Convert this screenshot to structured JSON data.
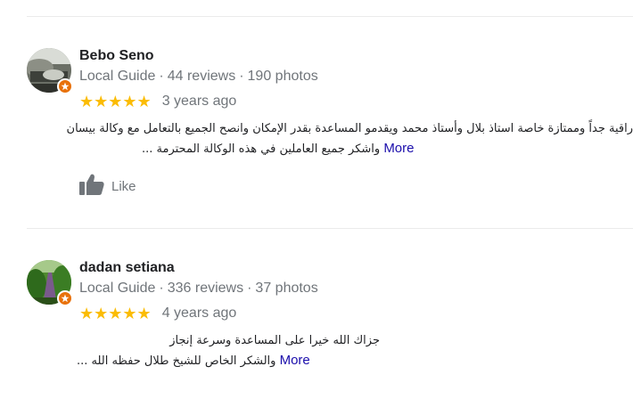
{
  "reviews": [
    {
      "author": "Bebo Seno",
      "guide_label": "Local Guide",
      "reviews_count": "44 reviews",
      "photos_count": "190 photos",
      "stars": "★★★★★",
      "rating": 5,
      "date": "3 years ago",
      "text_line1": "راقية جداً وممتازة خاصة استاذ بلال وأستاذ محمد ويقدمو المساعدة بقدر الإمكان وانصح الجميع بالتعامل مع وكالة بيسان",
      "text_line2": "واشكر جميع العاملين في هذه الوكالة المحترمة ...",
      "more_label": "More",
      "like_label": "Like",
      "avatar_icon": "profile-photo-icon",
      "badge_icon": "local-guide-star-icon"
    },
    {
      "author": "dadan setiana",
      "guide_label": "Local Guide",
      "reviews_count": "336 reviews",
      "photos_count": "37 photos",
      "stars": "★★★★★",
      "rating": 5,
      "date": "4 years ago",
      "text_line1": "جزاك الله خيرا على المساعدة وسرعة إنجاز",
      "text_line2": "والشكر الخاص للشيخ طلال حفظه الله ...",
      "more_label": "More",
      "avatar_icon": "profile-photo-icon",
      "badge_icon": "local-guide-star-icon"
    }
  ],
  "separator": "·",
  "colors": {
    "star": "#fbbc04",
    "badge": "#e8710a",
    "link": "#1a0dab",
    "muted": "#70757a",
    "divider": "#ebebeb"
  }
}
